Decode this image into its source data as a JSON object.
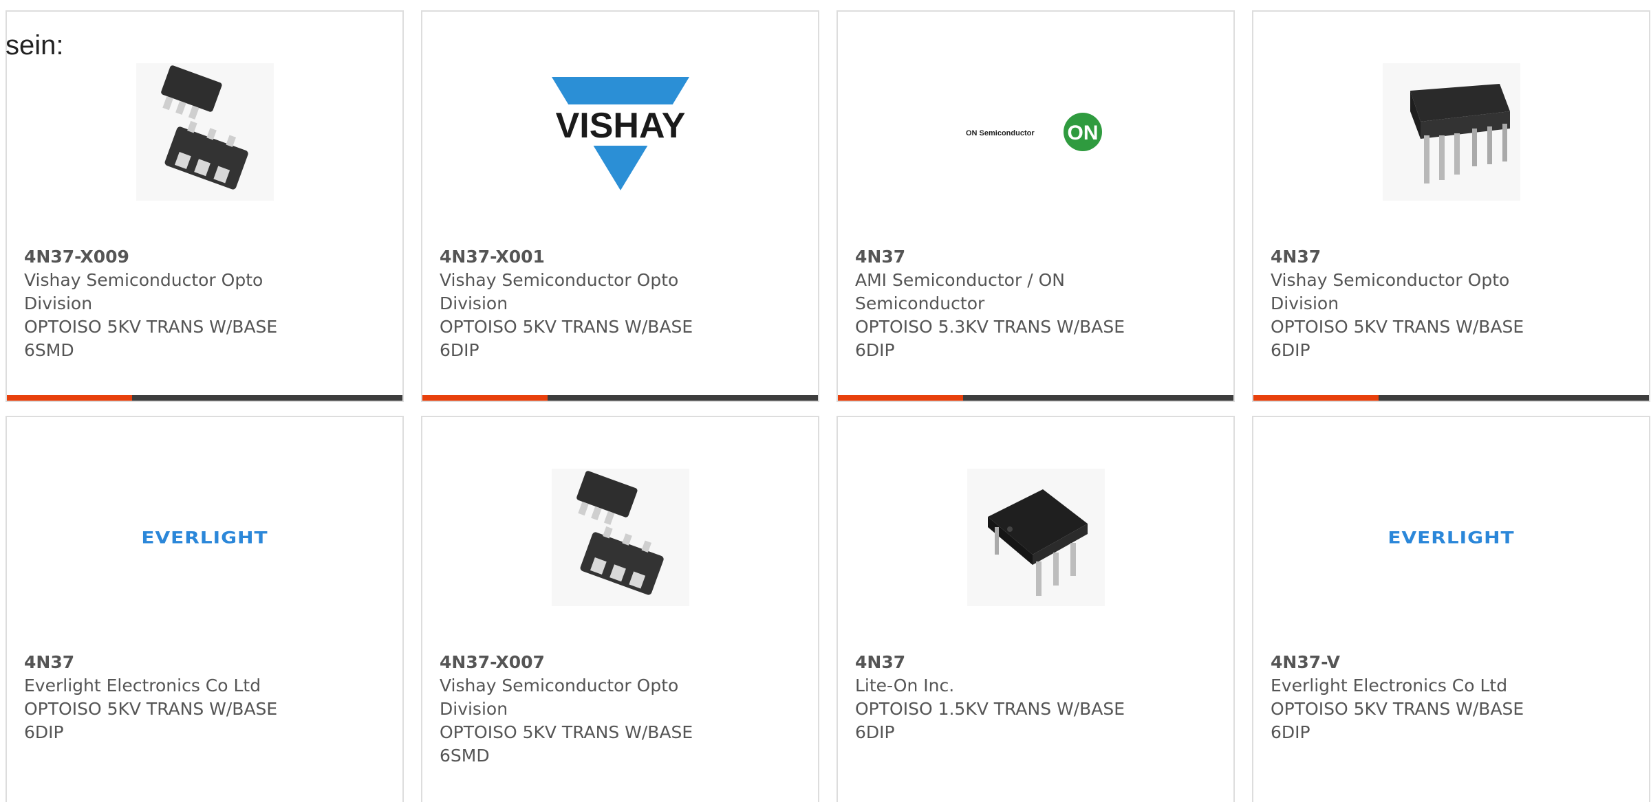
{
  "intro_text": "sein:",
  "colors": {
    "accent": "#e8400c",
    "bar": "#3d3d3d",
    "border": "#dddddd",
    "text": "#555555"
  },
  "products": [
    {
      "part": "4N37-X009",
      "maker_line1": "Vishay Semiconductor Opto",
      "maker_line2": "Division",
      "desc": "OPTOISO 5KV TRANS W/BASE",
      "pkg": "6SMD",
      "image": "smd-chip-photo"
    },
    {
      "part": "4N37-X001",
      "maker_line1": "Vishay Semiconductor Opto",
      "maker_line2": "Division",
      "desc": "OPTOISO 5KV TRANS W/BASE",
      "pkg": "6DIP",
      "image": "vishay-logo",
      "logo_text": "VISHAY"
    },
    {
      "part": "4N37",
      "maker_line1": "AMI Semiconductor / ON",
      "maker_line2": "Semiconductor",
      "desc": "OPTOISO 5.3KV TRANS W/BASE",
      "pkg": "6DIP",
      "image": "on-semiconductor-logo",
      "logo_text": "ON Semiconductor",
      "badge_text": "ON"
    },
    {
      "part": "4N37",
      "maker_line1": "Vishay Semiconductor Opto",
      "maker_line2": "Division",
      "desc": "OPTOISO 5KV TRANS W/BASE",
      "pkg": "6DIP",
      "image": "dip-chip-photo"
    },
    {
      "part": "4N37",
      "maker_line1": "Everlight Electronics Co Ltd",
      "maker_line2": "",
      "desc": "OPTOISO 5KV TRANS W/BASE",
      "pkg": "6DIP",
      "image": "everlight-logo",
      "logo_text": "EVERLIGHT"
    },
    {
      "part": "4N37-X007",
      "maker_line1": "Vishay Semiconductor Opto",
      "maker_line2": "Division",
      "desc": "OPTOISO 5KV TRANS W/BASE",
      "pkg": "6SMD",
      "image": "smd-chip-photo"
    },
    {
      "part": "4N37",
      "maker_line1": "Lite-On Inc.",
      "maker_line2": "",
      "desc": "OPTOISO 1.5KV TRANS W/BASE",
      "pkg": "6DIP",
      "image": "small-dip-chip-photo"
    },
    {
      "part": "4N37-V",
      "maker_line1": "Everlight Electronics Co Ltd",
      "maker_line2": "",
      "desc": "OPTOISO 5KV TRANS W/BASE",
      "pkg": "6DIP",
      "image": "everlight-logo",
      "logo_text": "EVERLIGHT"
    }
  ]
}
